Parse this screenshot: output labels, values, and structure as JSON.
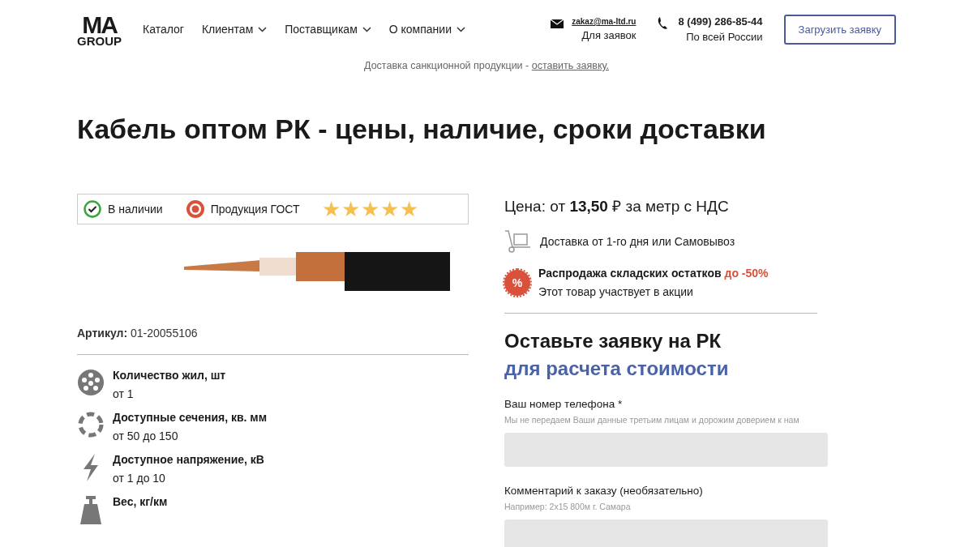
{
  "header": {
    "logo": {
      "top": "MA",
      "bottom": "GROUP"
    },
    "nav": [
      {
        "label": "Каталог",
        "dropdown": false
      },
      {
        "label": "Клиентам",
        "dropdown": true
      },
      {
        "label": "Поставщикам",
        "dropdown": true
      },
      {
        "label": "О компании",
        "dropdown": true
      }
    ],
    "email": {
      "address": "zakaz@ma-ltd.ru",
      "caption": "Для заявок"
    },
    "phone": {
      "number": "8 (499) 286-85-44",
      "caption": "По всей России"
    },
    "button": "Загрузить заявку"
  },
  "notice": {
    "text": "Доставка санкционной продукции - ",
    "link": "оставить заявку."
  },
  "title": "Кабель оптом РК - цены, наличие, сроки доставки",
  "badges": {
    "in_stock": "В наличии",
    "gost": "Продукция ГОСТ",
    "stars": 5
  },
  "article": {
    "label": "Артикул:",
    "value": "01-20055106"
  },
  "specs": [
    {
      "kind": "cores",
      "label": "Количество жил, шт",
      "value": "от 1"
    },
    {
      "kind": "section",
      "label": "Доступные сечения, кв. мм",
      "value": "от 50 до 150"
    },
    {
      "kind": "voltage",
      "label": "Доступное напряжение, кВ",
      "value": "от 1 до 10"
    },
    {
      "kind": "weight",
      "label": "Вес, кг/км"
    }
  ],
  "price": "Цена: от **13,50** ₽ за метр с НДС",
  "delivery": "Доставка от 1-го дня или Самовывоз",
  "sale": {
    "icon": "%",
    "title": "Распродажа складских остатков",
    "discount": "до -50%",
    "note": "Этот товар участвует в акции"
  },
  "form": {
    "title": "Оставьте заявку на РК",
    "subtitle": "для расчета стоимости",
    "fields": [
      {
        "label": "Ваш номер телефона *",
        "hint": "Мы не передаем Ваши данные третьим лицам и дорожим доверием к нам"
      },
      {
        "label": "Комментарий к заказу (необязательно)",
        "hint": "Например: 2х15 800м г. Самара"
      }
    ]
  }
}
